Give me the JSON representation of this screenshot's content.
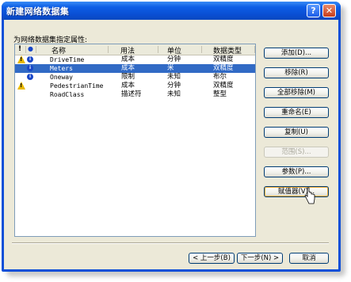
{
  "dialog": {
    "title": "新建网络数据集",
    "help_glyph": "?",
    "close_glyph": "✕"
  },
  "prompt": "为网络数据集指定属性:",
  "columns": {
    "warn": "!",
    "info": "●",
    "name": "名称",
    "usage": "用法",
    "unit": "单位",
    "data_type": "数据类型"
  },
  "rows": [
    {
      "warn": true,
      "info": true,
      "name": "DriveTime",
      "usage": "成本",
      "unit": "分钟",
      "data_type": "双精度",
      "selected": false
    },
    {
      "warn": false,
      "info": true,
      "name": "Meters",
      "usage": "成本",
      "unit": "米",
      "data_type": "双精度",
      "selected": true
    },
    {
      "warn": false,
      "info": true,
      "name": "Oneway",
      "usage": "限制",
      "unit": "未知",
      "data_type": "布尔",
      "selected": false
    },
    {
      "warn": true,
      "info": false,
      "name": "PedestrianTime",
      "usage": "成本",
      "unit": "分钟",
      "data_type": "双精度",
      "selected": false
    },
    {
      "warn": false,
      "info": false,
      "name": "RoadClass",
      "usage": "描述符",
      "unit": "未知",
      "data_type": "整型",
      "selected": false
    }
  ],
  "buttons": {
    "add": "添加(D)...",
    "remove": "移除(R)",
    "remove_all": "全部移除(M)",
    "rename": "重命名(E)",
    "duplicate": "复制(U)",
    "ranges": "范围(S)...",
    "parameters": "参数(P)...",
    "evaluators": "赋值器(V)..."
  },
  "nav": {
    "back": "< 上一步(B)",
    "next": "下一步(N) >",
    "cancel": "取消"
  }
}
